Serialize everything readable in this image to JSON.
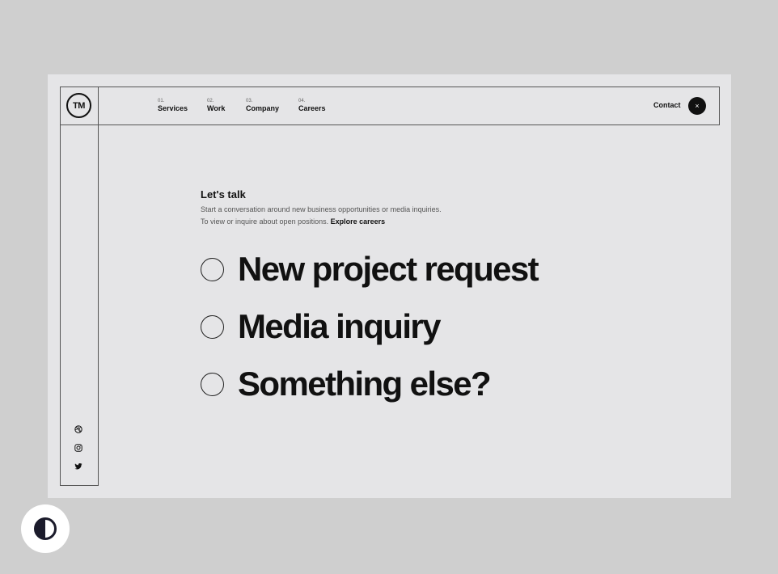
{
  "header": {
    "logo": "TM",
    "nav": [
      {
        "number": "01.",
        "label": "Services"
      },
      {
        "number": "02.",
        "label": "Work"
      },
      {
        "number": "03.",
        "label": "Company"
      },
      {
        "number": "04.",
        "label": "Careers"
      }
    ],
    "contact_label": "Contact",
    "close_symbol": "×"
  },
  "main": {
    "heading": "Let's talk",
    "line1": "Start a conversation around new business opportunities or media inquiries.",
    "line2_prefix": "To view or inquire about open positions.",
    "careers_link": "Explore careers",
    "options": [
      {
        "label": "New project request"
      },
      {
        "label": "Media inquiry"
      },
      {
        "label": "Something else?"
      }
    ]
  },
  "social": [
    "dribbble-icon",
    "instagram-icon",
    "twitter-icon"
  ],
  "theme_toggle": "contrast-icon",
  "colors": {
    "background": "#cfcfcf",
    "panel": "#e5e5e7",
    "text": "#111111",
    "button": "#111111"
  }
}
